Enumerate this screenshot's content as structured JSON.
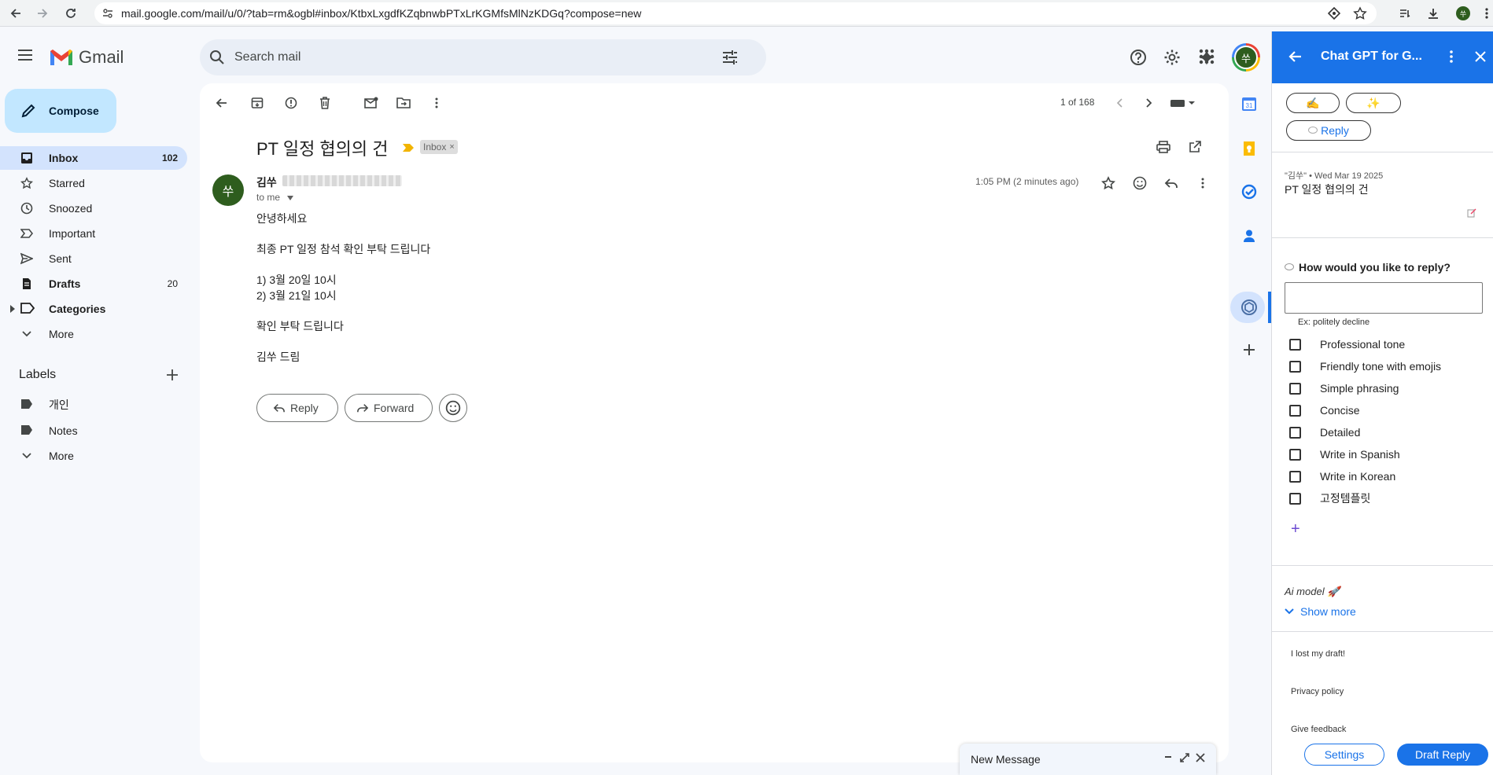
{
  "browser": {
    "url": "mail.google.com/mail/u/0/?tab=rm&ogbl#inbox/KtbxLxgdfKZqbnwbPTxLrKGMfsMlNzKDGq?compose=new"
  },
  "header": {
    "app_name": "Gmail",
    "search_placeholder": "Search mail",
    "avatar_initial": "쑤"
  },
  "sidebar": {
    "compose_label": "Compose",
    "items": [
      {
        "label": "Inbox",
        "count": "102"
      },
      {
        "label": "Starred",
        "count": ""
      },
      {
        "label": "Snoozed",
        "count": ""
      },
      {
        "label": "Important",
        "count": ""
      },
      {
        "label": "Sent",
        "count": ""
      },
      {
        "label": "Drafts",
        "count": "20"
      },
      {
        "label": "Categories",
        "count": ""
      },
      {
        "label": "More",
        "count": ""
      }
    ],
    "labels_title": "Labels",
    "labels": [
      {
        "label": "개인"
      },
      {
        "label": "Notes"
      },
      {
        "label": "More"
      }
    ]
  },
  "email": {
    "pager": "1 of 168",
    "subject": "PT 일정 협의의 건",
    "folder_chip": "Inbox",
    "chip_close": "×",
    "sender_name": "김쑤",
    "sender_initial": "쑤",
    "to": "to me",
    "timestamp": "1:05 PM (2 minutes ago)",
    "body": [
      "안녕하세요",
      "최종 PT 일정 참석 확인 부탁 드립니다",
      "1) 3월 20일 10시",
      "2) 3월 21일 10시",
      "확인 부탁 드립니다",
      "김쑤 드림"
    ],
    "reply_label": "Reply",
    "forward_label": "Forward"
  },
  "gpt_panel": {
    "title": "Chat GPT for G...",
    "pill_1": "✍️",
    "pill_2": "✨",
    "reply_pill": "Reply",
    "meta": "\"김쑤\" • Wed Mar 19 2025",
    "meta_subject": "PT 일정 협의의 건",
    "question": "How would you like to reply?",
    "input_value": "",
    "hint": "Ex: politely decline",
    "options": [
      "Professional tone",
      "Friendly tone with emojis",
      "Simple phrasing",
      "Concise",
      "Detailed",
      "Write in Spanish",
      "Write in Korean",
      "고정템플릿"
    ],
    "add_label": "+",
    "ai_model": "Ai model 🚀",
    "show_more": "Show more",
    "links": [
      "I lost my draft!",
      "Privacy policy",
      "Give feedback"
    ],
    "settings_label": "Settings",
    "draft_reply_label": "Draft Reply"
  },
  "compose_window": {
    "title": "New Message"
  },
  "colors": {
    "accent": "#1a73e8",
    "compose_bg": "#c2e7ff",
    "active_nav": "#d3e3fd",
    "avatar_green": "#2e5d1e"
  }
}
